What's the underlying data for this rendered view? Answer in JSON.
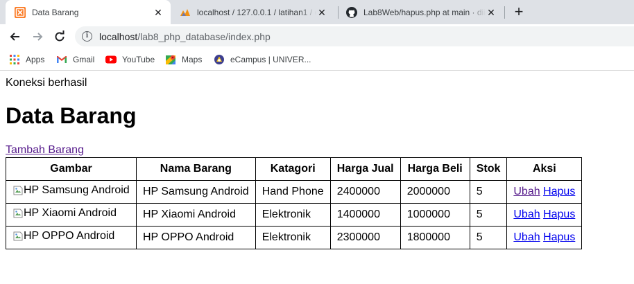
{
  "browser": {
    "tabs": [
      {
        "title": "Data Barang",
        "icon": "xampp-icon",
        "active": true
      },
      {
        "title": "localhost / 127.0.0.1 / latihan1 / d",
        "icon": "phpmyadmin-icon",
        "active": false
      },
      {
        "title": "Lab8Web/hapus.php at main · dii",
        "icon": "github-icon",
        "active": false
      }
    ],
    "close_glyph": "✕",
    "new_tab_glyph": "+",
    "url_host": "localhost",
    "url_path": "/lab8_php_database/index.php",
    "bookmarks": [
      {
        "label": "Apps",
        "icon": "apps-grid-icon"
      },
      {
        "label": "Gmail",
        "icon": "gmail-icon"
      },
      {
        "label": "YouTube",
        "icon": "youtube-icon"
      },
      {
        "label": "Maps",
        "icon": "maps-icon"
      },
      {
        "label": "eCampus | UNIVER...",
        "icon": "ecampus-icon"
      }
    ]
  },
  "page": {
    "status": "Koneksi berhasil",
    "heading": "Data Barang",
    "add_link": "Tambah Barang",
    "columns": [
      "Gambar",
      "Nama Barang",
      "Katagori",
      "Harga Jual",
      "Harga Beli",
      "Stok",
      "Aksi"
    ],
    "rows": [
      {
        "image_alt": "HP Samsung Android",
        "nama": "HP Samsung Android",
        "kategori": "Hand Phone",
        "harga_jual": "2400000",
        "harga_beli": "2000000",
        "stok": "5",
        "edit": "Ubah",
        "delete": "Hapus"
      },
      {
        "image_alt": "HP Xiaomi Android",
        "nama": "HP Xiaomi Android",
        "kategori": "Elektronik",
        "harga_jual": "1400000",
        "harga_beli": "1000000",
        "stok": "5",
        "edit": "Ubah",
        "delete": "Hapus"
      },
      {
        "image_alt": "HP OPPO Android",
        "nama": "HP OPPO Android",
        "kategori": "Elektronik",
        "harga_jual": "2300000",
        "harga_beli": "1800000",
        "stok": "5",
        "edit": "Ubah",
        "delete": "Hapus"
      }
    ]
  },
  "colors": {
    "tabstrip": "#dee1e6",
    "link": "#0000ee",
    "visited_link": "#551a8b"
  }
}
